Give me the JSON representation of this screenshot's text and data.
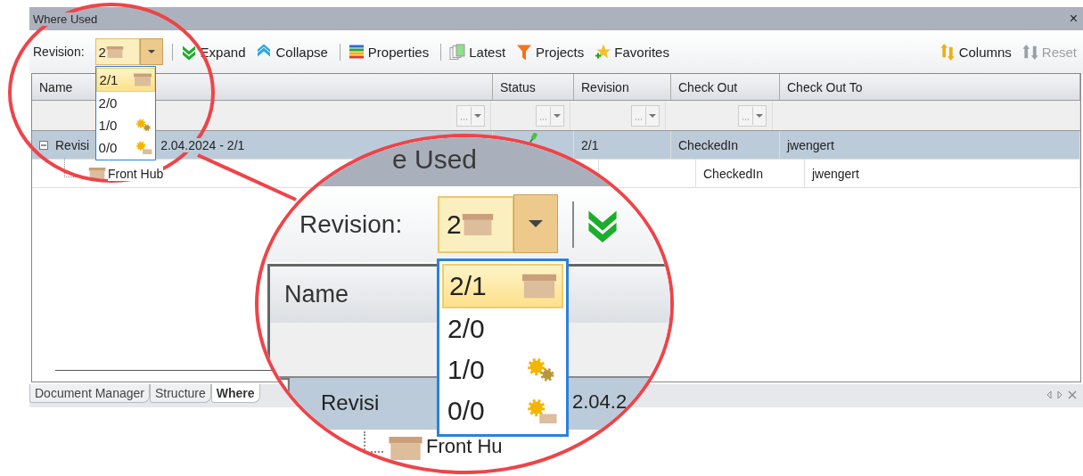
{
  "window": {
    "title": "Where Used",
    "close": "×"
  },
  "toolbar": {
    "revision_label": "Revision:",
    "revision_value": "2",
    "items": [
      {
        "label": "Expand",
        "kind": "expand",
        "separator_before": true
      },
      {
        "label": "Collapse",
        "kind": "collapse",
        "separator_before": false
      },
      {
        "label": "Properties",
        "kind": "properties",
        "separator_before": true
      },
      {
        "label": "Latest",
        "kind": "latest",
        "separator_before": true
      },
      {
        "label": "Projects",
        "kind": "projects",
        "separator_before": false
      },
      {
        "label": "Favorites",
        "kind": "favorites",
        "separator_before": false
      }
    ],
    "right_items": [
      {
        "label": "Columns",
        "kind": "columns",
        "disabled": false
      },
      {
        "label": "Reset",
        "kind": "reset",
        "disabled": true
      }
    ]
  },
  "revision_dropdown": [
    {
      "label": "2/1",
      "kind": "box",
      "selected": true
    },
    {
      "label": "2/0",
      "kind": "plain",
      "selected": false
    },
    {
      "label": "1/0",
      "kind": "gears",
      "selected": false
    },
    {
      "label": "0/0",
      "kind": "gear-box",
      "selected": false
    }
  ],
  "table": {
    "columns": [
      {
        "label": "Name",
        "filter": true
      },
      {
        "label": "Status",
        "filter": true
      },
      {
        "label": "Revision",
        "filter": true
      },
      {
        "label": "Check Out",
        "filter": true
      },
      {
        "label": "Check Out To",
        "filter": false
      }
    ],
    "rows": [
      {
        "name_start": "Revisi",
        "name_end": "2.04.2024 - 2/1",
        "expanded": true,
        "selected": true,
        "status_marked": true,
        "revision": "2/1",
        "check_out": "CheckedIn",
        "check_out_to": "jwengert",
        "children": [
          {
            "name": "Front Hub",
            "selected": false,
            "check_out": "CheckedIn",
            "check_out_to": "jwengert"
          }
        ]
      }
    ]
  },
  "tabs": [
    {
      "label": "Document Manager",
      "selected": false
    },
    {
      "label": "Structure",
      "selected": false
    },
    {
      "label": "Where",
      "selected": true
    }
  ],
  "magnifier": {
    "title_fragment": "e Used",
    "revision_label": "Revision:",
    "revision_value": "2",
    "name_header": "Name",
    "row_name_start": "Revisi",
    "row_name_end": "2.04.2",
    "child_name": "Front Hu",
    "dropdown": [
      {
        "label": "2/1",
        "kind": "box",
        "selected": true
      },
      {
        "label": "2/0",
        "kind": "plain",
        "selected": false
      },
      {
        "label": "1/0",
        "kind": "gears",
        "selected": false
      },
      {
        "label": "0/0",
        "kind": "gear-box",
        "selected": false
      }
    ]
  }
}
